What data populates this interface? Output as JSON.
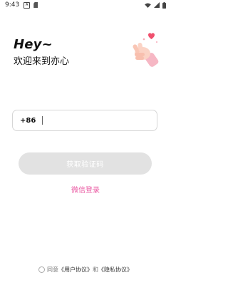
{
  "status_bar": {
    "time": "9:43",
    "app_badge": "A"
  },
  "greeting": {
    "hey": "Hey~",
    "welcome": "欢迎来到亦心"
  },
  "phone": {
    "country_code": "+86"
  },
  "buttons": {
    "get_code": "获取验证码",
    "wechat_login": "微信登录"
  },
  "agreement": {
    "prefix": "同意",
    "user_agreement": "《用户协议》",
    "and": "和",
    "privacy_agreement": "《隐私协议》"
  },
  "colors": {
    "accent": "#ea5aa3",
    "button_disabled": "#e2e2e2"
  },
  "icons": [
    "wifi-icon",
    "signal-icon",
    "battery-icon",
    "hand-heart-illustration"
  ]
}
